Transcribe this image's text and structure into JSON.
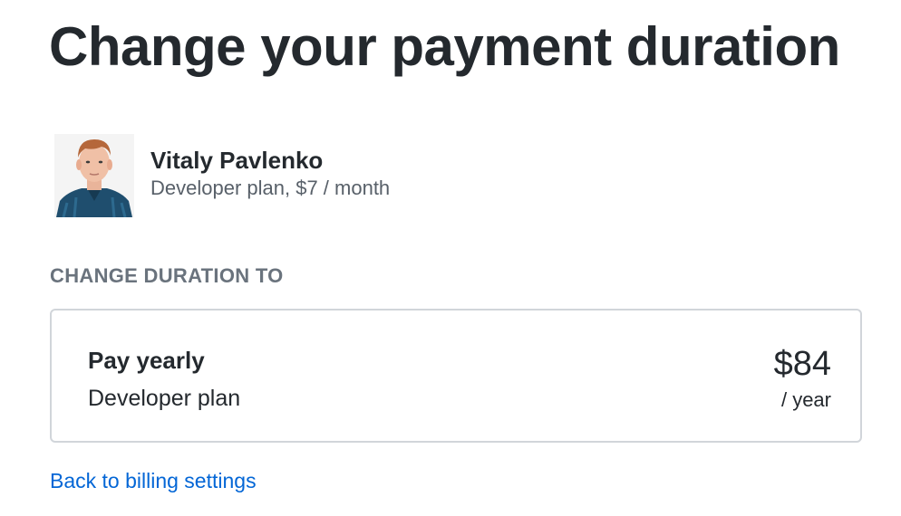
{
  "page": {
    "title": "Change your payment duration"
  },
  "account": {
    "name": "Vitaly Pavlenko",
    "plan": "Developer plan, $7 / month"
  },
  "section": {
    "label": "CHANGE DURATION TO"
  },
  "option": {
    "title": "Pay yearly",
    "plan": "Developer plan",
    "price": "$84",
    "period": "/ year"
  },
  "links": {
    "back": "Back to billing settings"
  },
  "colors": {
    "text": "#24292e",
    "muted": "#586069",
    "label": "#6a737d",
    "border": "#d1d5da",
    "link": "#0366d6"
  }
}
